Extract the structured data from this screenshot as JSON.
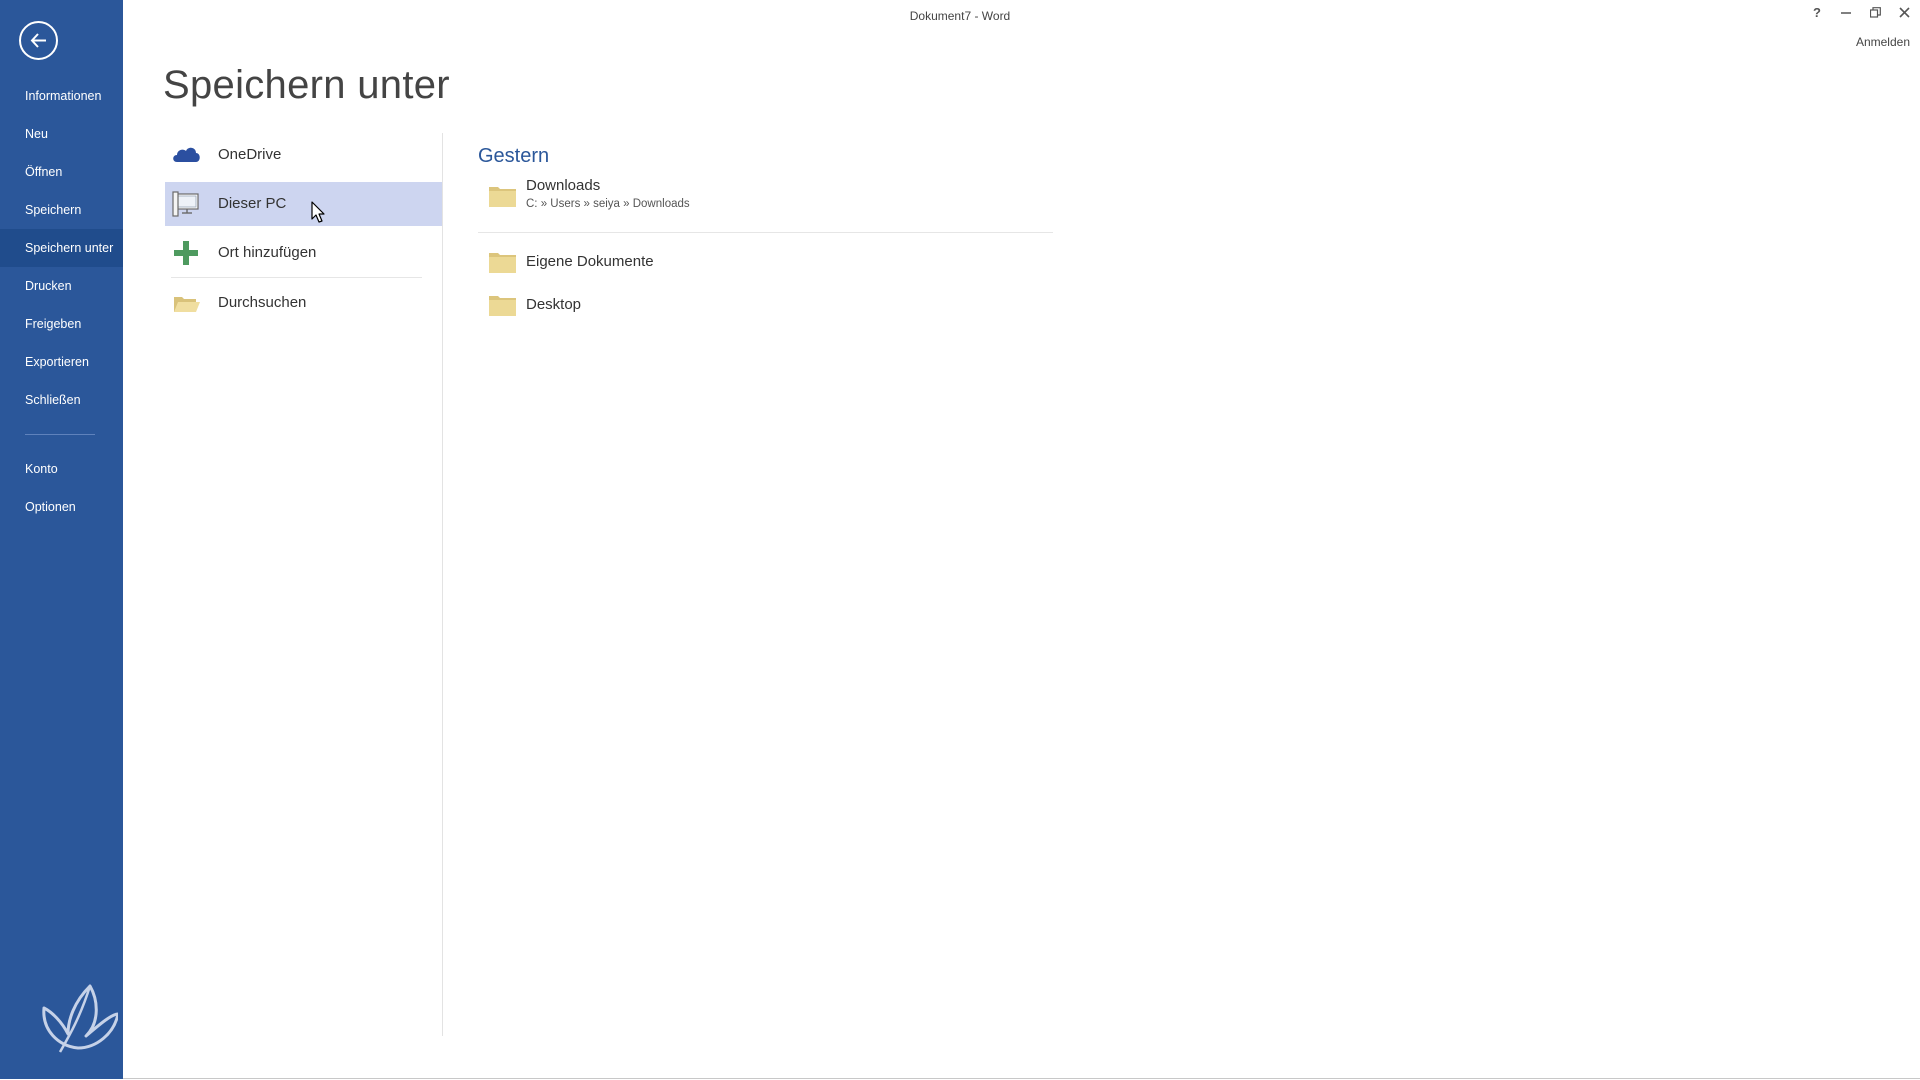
{
  "window": {
    "title": "Dokument7 - Word",
    "help_label": "?",
    "sign_in": "Anmelden"
  },
  "sidebar": {
    "items": [
      {
        "label": "Informationen",
        "selected": false
      },
      {
        "label": "Neu",
        "selected": false
      },
      {
        "label": "Öffnen",
        "selected": false
      },
      {
        "label": "Speichern",
        "selected": false
      },
      {
        "label": "Speichern unter",
        "selected": true
      },
      {
        "label": "Drucken",
        "selected": false
      },
      {
        "label": "Freigeben",
        "selected": false
      },
      {
        "label": "Exportieren",
        "selected": false
      },
      {
        "label": "Schließen",
        "selected": false
      }
    ],
    "bottom_items": [
      {
        "label": "Konto"
      },
      {
        "label": "Optionen"
      }
    ]
  },
  "main": {
    "title": "Speichern unter",
    "places": [
      {
        "label": "OneDrive",
        "icon": "cloud-icon",
        "selected": false
      },
      {
        "label": "Dieser PC",
        "icon": "computer-icon",
        "selected": true
      },
      {
        "label": "Ort hinzufügen",
        "icon": "plus-icon",
        "selected": false
      },
      {
        "label": "Durchsuchen",
        "icon": "open-folder-icon",
        "selected": false
      }
    ],
    "recent": {
      "heading": "Gestern",
      "folders": [
        {
          "name": "Downloads",
          "path": "C: » Users » seiya » Downloads"
        },
        {
          "name": "Eigene Dokumente"
        },
        {
          "name": "Desktop"
        }
      ]
    }
  },
  "colors": {
    "sidebar": "#2b579a",
    "sidebar_selected": "#204c8c",
    "place_selected": "#cdd5f0",
    "heading_accent": "#2b579a",
    "folder": "#e8d18a"
  }
}
